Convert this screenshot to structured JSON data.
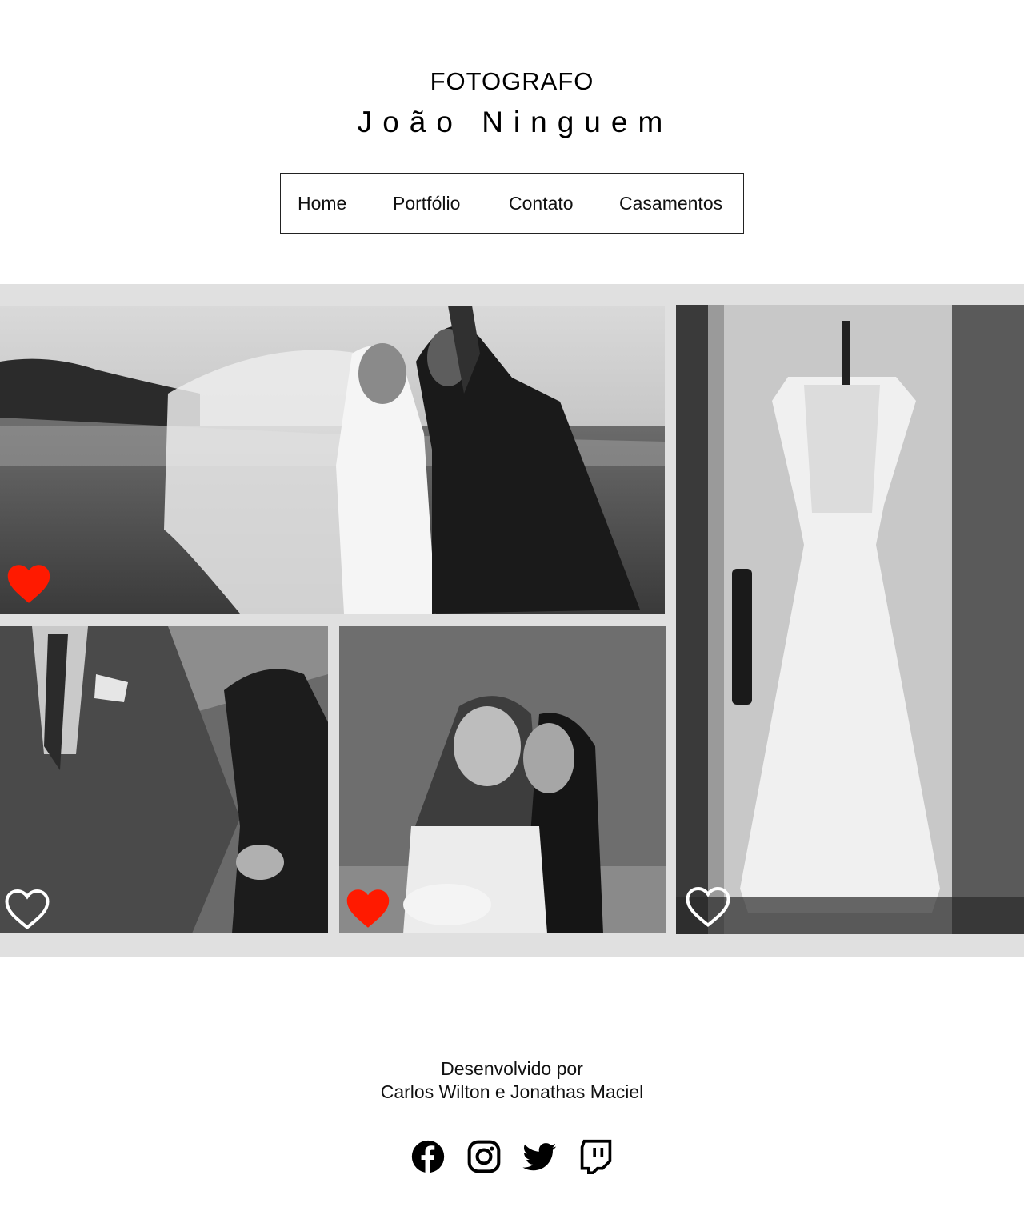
{
  "header": {
    "label": "FOTOGRAFO",
    "photographer": "João Ninguem"
  },
  "nav": {
    "items": [
      {
        "label": "Home"
      },
      {
        "label": "Portfólio"
      },
      {
        "label": "Contato"
      },
      {
        "label": "Casamentos"
      }
    ]
  },
  "gallery": {
    "photos": [
      {
        "subject": "couple kissing under veil on beach",
        "liked": true
      },
      {
        "subject": "groom holding hands in suit",
        "liked": false
      },
      {
        "subject": "two brides embracing with bouquet",
        "liked": true
      },
      {
        "subject": "wedding dress hanging on door",
        "liked": false
      }
    ]
  },
  "footer": {
    "line1": "Desenvolvido por",
    "line2": "Carlos Wilton e Jonathas Maciel",
    "socials": [
      "facebook-icon",
      "instagram-icon",
      "twitter-icon",
      "twitch-icon"
    ]
  },
  "colors": {
    "heart_liked": "#ff1a00",
    "heart_outline": "#ffffff",
    "gallery_bg": "#e0e0e0"
  }
}
